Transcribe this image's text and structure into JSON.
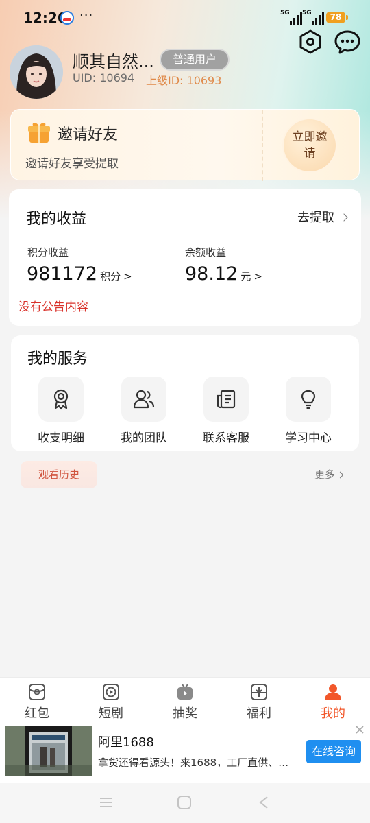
{
  "status_bar": {
    "time": "12:26",
    "dots": "···",
    "signal_1_label": "5G",
    "signal_2_label": "5G",
    "battery": "78"
  },
  "profile": {
    "name": "顺其自然...",
    "role": "普通用户",
    "uid": "UID: 10694",
    "parent_id": "上级ID: 10693"
  },
  "invite": {
    "title": "邀请好友",
    "subtitle": "邀请好友享受提取",
    "button": "立即邀请"
  },
  "earnings": {
    "title": "我的收益",
    "withdraw": "去提取",
    "points_label": "积分收益",
    "points_value": "981172",
    "points_unit": "积分",
    "balance_label": "余额收益",
    "balance_value": "98.12",
    "balance_unit": "元",
    "arrow": ">",
    "notice": "没有公告内容"
  },
  "services": {
    "title": "我的服务",
    "items": [
      {
        "label": "收支明细",
        "icon": "badge-icon"
      },
      {
        "label": "我的团队",
        "icon": "team-icon"
      },
      {
        "label": "联系客服",
        "icon": "document-icon"
      },
      {
        "label": "学习中心",
        "icon": "lightbulb-icon"
      }
    ]
  },
  "history": {
    "tab": "观看历史",
    "more": "更多"
  },
  "bottom_nav": {
    "items": [
      {
        "label": "红包",
        "icon": "red-packet-icon"
      },
      {
        "label": "短剧",
        "icon": "play-icon"
      },
      {
        "label": "抽奖",
        "icon": "tv-icon"
      },
      {
        "label": "福利",
        "icon": "gift-box-icon"
      },
      {
        "label": "我的",
        "icon": "person-icon"
      }
    ],
    "active_index": 4
  },
  "ad": {
    "title": "阿里1688",
    "description": "拿货还得看源头！来1688，工厂直供、…",
    "cta": "在线咨询"
  },
  "colors": {
    "accent": "#f2572a",
    "notice_red": "#d9322b",
    "cta_blue": "#1f8ff0",
    "parent_id_orange": "#e08a4a"
  }
}
